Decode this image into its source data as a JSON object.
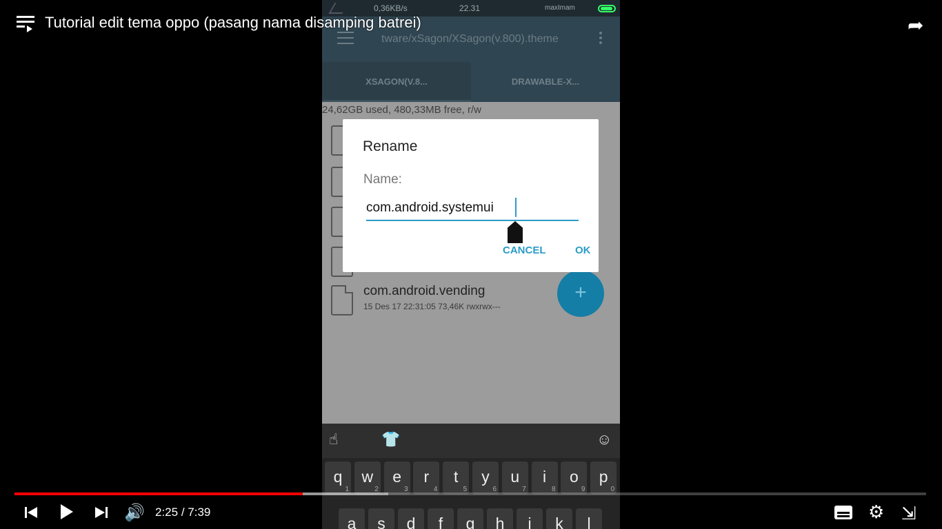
{
  "youtube": {
    "video_title": "Tutorial edit tema oppo (pasang nama disamping batrei)",
    "time_current": "2:25",
    "time_total": "7:39",
    "played_fraction": 0.316,
    "buffered_fraction": 0.41,
    "icons": {
      "playlist": "playlist-icon",
      "share": "share-icon",
      "prev": "skip-previous-icon",
      "play": "play-icon",
      "next": "skip-next-icon",
      "volume": "volume-icon",
      "subtitles": "subtitles-icon",
      "settings": "gear-icon",
      "exit_fullscreen": "exit-fullscreen-icon"
    }
  },
  "phone": {
    "status_bar": {
      "speed": "0,36KB/s",
      "time": "22.31",
      "carrier": "maxImam"
    },
    "app_bar": {
      "path": "tware/xSagon/XSagon(v.800).theme"
    },
    "tabs": [
      {
        "label": "XSAGON(V.8..."
      },
      {
        "label": "DRAWABLE-X..."
      }
    ],
    "storage_info": "24,62GB used, 480,33MB free, r/w",
    "file": {
      "name": "com.android.vending",
      "meta": "15 Des 17 22:31:05  73,46K  rwxrwx---"
    },
    "dialog": {
      "title": "Rename",
      "name_label": "Name:",
      "input_value": "com.android.systemui",
      "cancel_label": "CANCEL",
      "ok_label": "OK"
    },
    "keyboard": {
      "row1": [
        {
          "key": "q",
          "hint": "1"
        },
        {
          "key": "w",
          "hint": "2"
        },
        {
          "key": "e",
          "hint": "3"
        },
        {
          "key": "r",
          "hint": "4"
        },
        {
          "key": "t",
          "hint": "5"
        },
        {
          "key": "y",
          "hint": "6"
        },
        {
          "key": "u",
          "hint": "7"
        },
        {
          "key": "i",
          "hint": "8"
        },
        {
          "key": "o",
          "hint": "9"
        },
        {
          "key": "p",
          "hint": "0"
        }
      ],
      "row2": [
        "a",
        "s",
        "d",
        "f",
        "g",
        "h",
        "j",
        "k",
        "l"
      ]
    },
    "colors": {
      "accent": "#2a9cc8",
      "app_bar": "#2f4551",
      "fab": "#157ea6"
    }
  }
}
